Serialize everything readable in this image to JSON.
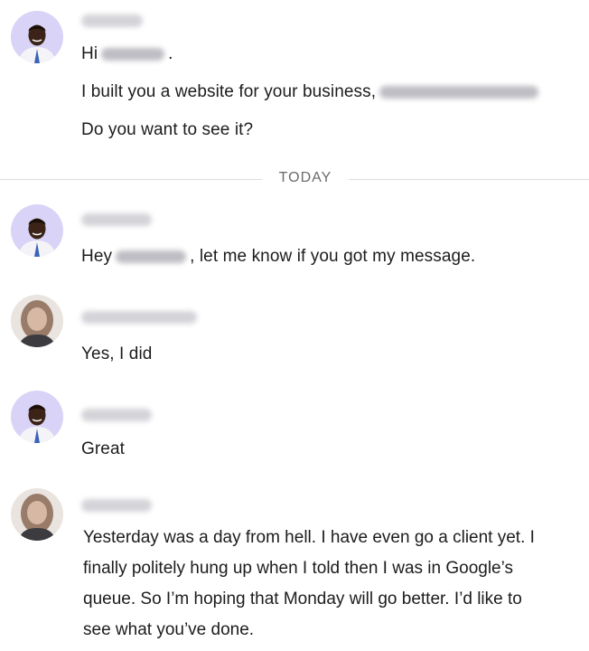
{
  "messages_before": [
    {
      "sender": "agent",
      "lines": {
        "greeting_start": "Hi",
        "greeting_end": ".",
        "website": "I built you a website for your business,",
        "question": "Do you want to see it?"
      }
    }
  ],
  "divider": {
    "label": "TODAY"
  },
  "messages": [
    {
      "sender": "agent",
      "text_before": "Hey",
      "text_after": ", let me know if you got my message."
    },
    {
      "sender": "client",
      "text": "Yes, I did"
    },
    {
      "sender": "agent",
      "text": "Great"
    },
    {
      "sender": "client",
      "text": "Yesterday was a day from hell. I have even go a client yet. I finally politely hung up when I told then I was in Google’s queue. So I’m hoping that Monday will go better. I’d like to see what you’ve done."
    }
  ],
  "colors": {
    "agent_avatar_bg": "#d9d3f7",
    "client_avatar_bg": "#e9e4df",
    "divider_text": "#6b6b6b"
  }
}
